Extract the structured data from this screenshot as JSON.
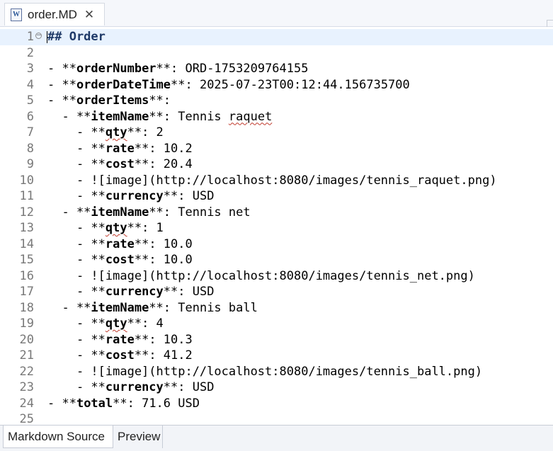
{
  "tab": {
    "file_icon": "W",
    "title": "order.MD",
    "close": "✕"
  },
  "editor": {
    "lines": [
      {
        "n": "1",
        "segs": [
          {
            "t": "## Order",
            "c": "hdr"
          }
        ]
      },
      {
        "n": "2",
        "segs": []
      },
      {
        "n": "3",
        "segs": [
          {
            "t": "- **"
          },
          {
            "t": "orderNumber",
            "c": "b"
          },
          {
            "t": "**: ORD-1753209764155"
          }
        ]
      },
      {
        "n": "4",
        "segs": [
          {
            "t": "- **"
          },
          {
            "t": "orderDateTime",
            "c": "b"
          },
          {
            "t": "**: 2025-07-23T00:12:44.156735700"
          }
        ]
      },
      {
        "n": "5",
        "segs": [
          {
            "t": "- **"
          },
          {
            "t": "orderItems",
            "c": "b"
          },
          {
            "t": "**:"
          }
        ]
      },
      {
        "n": "6",
        "segs": [
          {
            "t": "  - **"
          },
          {
            "t": "itemName",
            "c": "b"
          },
          {
            "t": "**: Tennis "
          },
          {
            "t": "raquet",
            "c": "sq"
          }
        ]
      },
      {
        "n": "7",
        "segs": [
          {
            "t": "    - **"
          },
          {
            "t": "qty",
            "c": "b sq"
          },
          {
            "t": "**: 2"
          }
        ]
      },
      {
        "n": "8",
        "segs": [
          {
            "t": "    - **"
          },
          {
            "t": "rate",
            "c": "b"
          },
          {
            "t": "**: 10.2"
          }
        ]
      },
      {
        "n": "9",
        "segs": [
          {
            "t": "    - **"
          },
          {
            "t": "cost",
            "c": "b"
          },
          {
            "t": "**: 20.4"
          }
        ]
      },
      {
        "n": "10",
        "segs": [
          {
            "t": "    - ![image](http://localhost:8080/images/tennis_raquet.png)"
          }
        ]
      },
      {
        "n": "11",
        "segs": [
          {
            "t": "    - **"
          },
          {
            "t": "currency",
            "c": "b"
          },
          {
            "t": "**: USD"
          }
        ]
      },
      {
        "n": "12",
        "segs": [
          {
            "t": "  - **"
          },
          {
            "t": "itemName",
            "c": "b"
          },
          {
            "t": "**: Tennis net"
          }
        ]
      },
      {
        "n": "13",
        "segs": [
          {
            "t": "    - **"
          },
          {
            "t": "qty",
            "c": "b sq"
          },
          {
            "t": "**: 1"
          }
        ]
      },
      {
        "n": "14",
        "segs": [
          {
            "t": "    - **"
          },
          {
            "t": "rate",
            "c": "b"
          },
          {
            "t": "**: 10.0"
          }
        ]
      },
      {
        "n": "15",
        "segs": [
          {
            "t": "    - **"
          },
          {
            "t": "cost",
            "c": "b"
          },
          {
            "t": "**: 10.0"
          }
        ]
      },
      {
        "n": "16",
        "segs": [
          {
            "t": "    - ![image](http://localhost:8080/images/tennis_net.png)"
          }
        ]
      },
      {
        "n": "17",
        "segs": [
          {
            "t": "    - **"
          },
          {
            "t": "currency",
            "c": "b"
          },
          {
            "t": "**: USD"
          }
        ]
      },
      {
        "n": "18",
        "segs": [
          {
            "t": "  - **"
          },
          {
            "t": "itemName",
            "c": "b"
          },
          {
            "t": "**: Tennis ball"
          }
        ]
      },
      {
        "n": "19",
        "segs": [
          {
            "t": "    - **"
          },
          {
            "t": "qty",
            "c": "b sq"
          },
          {
            "t": "**: 4"
          }
        ]
      },
      {
        "n": "20",
        "segs": [
          {
            "t": "    - **"
          },
          {
            "t": "rate",
            "c": "b"
          },
          {
            "t": "**: 10.3"
          }
        ]
      },
      {
        "n": "21",
        "segs": [
          {
            "t": "    - **"
          },
          {
            "t": "cost",
            "c": "b"
          },
          {
            "t": "**: 41.2"
          }
        ]
      },
      {
        "n": "22",
        "segs": [
          {
            "t": "    - ![image](http://localhost:8080/images/tennis_ball.png)"
          }
        ]
      },
      {
        "n": "23",
        "segs": [
          {
            "t": "    - **"
          },
          {
            "t": "currency",
            "c": "b"
          },
          {
            "t": "**: USD"
          }
        ]
      },
      {
        "n": "24",
        "segs": [
          {
            "t": "- **"
          },
          {
            "t": "total",
            "c": "b"
          },
          {
            "t": "**: 71.6 USD"
          }
        ]
      },
      {
        "n": "25",
        "segs": []
      }
    ]
  },
  "bottom_tabs": {
    "source": "Markdown Source",
    "preview": "Preview"
  }
}
